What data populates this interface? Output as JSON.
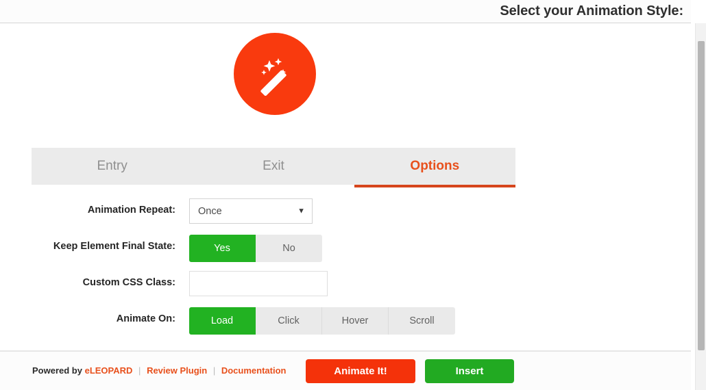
{
  "header": {
    "title": ":Select your Animation Style"
  },
  "badge": {
    "icon": "magic-wand-icon",
    "circle_color": "#f93a0e"
  },
  "tabs": [
    {
      "label": "Entry",
      "active": false
    },
    {
      "label": "Exit",
      "active": false
    },
    {
      "label": "Options",
      "active": true
    }
  ],
  "options": {
    "animation_repeat": {
      "label": "Animation Repeat:",
      "value": "Once",
      "caret": "▼"
    },
    "keep_final_state": {
      "label": "Keep Element Final State:",
      "choices": [
        "Yes",
        "No"
      ],
      "selected": "Yes"
    },
    "custom_css_class": {
      "label": "Custom CSS Class:",
      "value": "",
      "placeholder": ""
    },
    "animate_on": {
      "label": "Animate On:",
      "choices": [
        "Load",
        "Click",
        "Hover",
        "Scroll"
      ],
      "selected": "Load"
    }
  },
  "footer": {
    "powered_by": "Powered by",
    "brand": "eLEOPARD",
    "separator": "|",
    "review_link": "Review Plugin",
    "docs_link": "Documentation",
    "animate_button": "Animate It!",
    "insert_button": "Insert"
  },
  "colors": {
    "accent_red": "#e8501c",
    "brand_orange": "#f93a0e",
    "success_green": "#22b222",
    "tab_bar": "#ebebeb"
  }
}
